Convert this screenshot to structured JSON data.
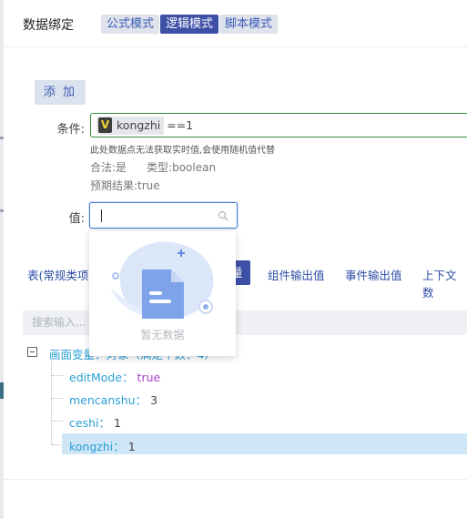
{
  "header": {
    "title": "数据绑定",
    "modes": [
      {
        "label": "公式模式",
        "active": false
      },
      {
        "label": "逻辑模式",
        "active": true
      },
      {
        "label": "脚本模式",
        "active": false
      }
    ]
  },
  "form": {
    "add_label": "添 加",
    "condition": {
      "label": "条件:",
      "var_badge": "V",
      "var_name": "kongzhi",
      "expression": "==1",
      "hint": "此处数据点无法获取实时值,会使用随机值代替",
      "legal_label": "合法:是",
      "type_label": "类型:boolean",
      "expected_label": "预期结果:true"
    },
    "value": {
      "label": "值:",
      "input_value": "",
      "empty_text": "暂无数据"
    }
  },
  "tabs": {
    "left_label": "表(常规类项",
    "active_fragment": "量",
    "items": [
      {
        "label": "组件输出值"
      },
      {
        "label": "事件输出值"
      },
      {
        "label": "上下文数"
      }
    ]
  },
  "search": {
    "placeholder": "搜索输入..."
  },
  "tree": {
    "root_label": "画面变量：对象（满足个数：4）",
    "nodes": [
      {
        "key": "editMode：",
        "value": "true",
        "kind": "bool"
      },
      {
        "key": "mencanshu：",
        "value": "3",
        "kind": "num"
      },
      {
        "key": "ceshi：",
        "value": "1",
        "kind": "num"
      },
      {
        "key": "kongzhi：",
        "value": "1",
        "kind": "num",
        "selected": true
      }
    ]
  },
  "colors": {
    "accent": "#3e4fa6",
    "tree_key": "#2a9fd6",
    "bool_value": "#a240c8",
    "selected_row": "#cfe6f7",
    "condition_border": "#3a8a3a"
  }
}
